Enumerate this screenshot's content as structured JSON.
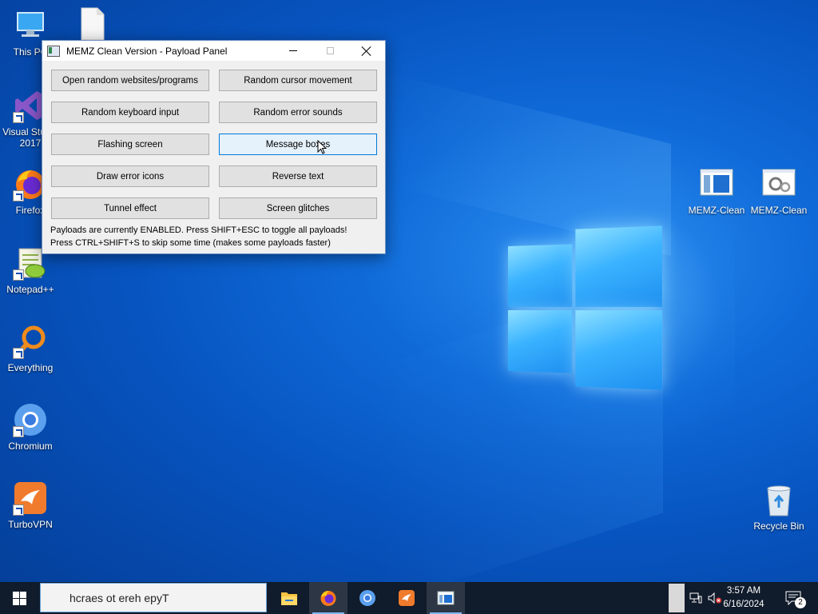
{
  "desktop": {
    "icons_left": [
      {
        "label": "This PC",
        "name": "this-pc"
      },
      {
        "label": "Visual Studio 2017",
        "name": "visual-studio"
      },
      {
        "label": "Firefox",
        "name": "firefox"
      },
      {
        "label": "Notepad++",
        "name": "notepadpp"
      },
      {
        "label": "Everything",
        "name": "everything"
      },
      {
        "label": "Chromium",
        "name": "chromium"
      },
      {
        "label": "TurboVPN",
        "name": "turbovpn"
      }
    ],
    "icons_right": [
      {
        "label": "MEMZ-Clean",
        "name": "memz-clean-1"
      },
      {
        "label": "MEMZ-Clean",
        "name": "memz-clean-2"
      },
      {
        "label": "Recycle Bin",
        "name": "recycle-bin"
      }
    ]
  },
  "window": {
    "title": "MEMZ Clean Version - Payload Panel",
    "buttons": [
      "Open random websites/programs",
      "Random cursor movement",
      "Random keyboard input",
      "Random error sounds",
      "Flashing screen",
      "Message boxes",
      "Draw error icons",
      "Reverse text",
      "Tunnel effect",
      "Screen glitches"
    ],
    "status_line1": "Payloads are currently ENABLED. Press SHIFT+ESC to toggle all payloads!",
    "status_line2": "Press CTRL+SHIFT+S to skip some time (makes some payloads faster)"
  },
  "taskbar": {
    "search_placeholder": "hcraes ot ereh epyT",
    "time": "3:57 AM",
    "date": "6/16/2024",
    "notification_count": "2",
    "pinned": [
      "file-explorer-icon",
      "firefox-icon",
      "chromium-icon",
      "turbovpn-icon",
      "memz-icon"
    ]
  },
  "colors": {
    "accent": "#0078d7",
    "taskbar": "#101b2b"
  }
}
